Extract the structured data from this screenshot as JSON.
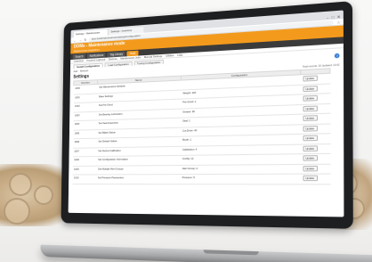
{
  "browser": {
    "tabs": [
      {
        "label": "Settings - Maintenance"
      },
      {
        "label": "Settings - Inventory"
      }
    ],
    "url": "dmx.local/maintenance/settings/configuration"
  },
  "app": {
    "title": "DDMx - Maintenance mode",
    "subtitle": "Maintenance Integration",
    "toolbar": [
      "Search",
      "Notifications",
      "Tag Library",
      "Tools"
    ],
    "toolbar_selected": 3,
    "menus": [
      "Overview",
      "Process Logbook",
      "Devices",
      "Maintenance Jobs",
      "Manual Settings",
      "Utilities",
      "Help"
    ],
    "subtabs": [
      "Install Configuration",
      "Load Configuration",
      "Tuning Configuration"
    ],
    "subtab_selected": 0,
    "tools": [
      "Add",
      "Refresh"
    ],
    "heading": "Settings",
    "help_icon": "question-circle-icon",
    "record_info": "Total records: 30   Updated: 10:42"
  },
  "table": {
    "headers": [
      "Number",
      "Name",
      "Configuration",
      ""
    ],
    "action_label": "Update",
    "rows": [
      {
        "id": "1000",
        "name": "Set Maintenance Defaults",
        "config": "",
        "action": "Update"
      },
      {
        "id": "1001",
        "name": "Base Settings",
        "config": "Weight: 100",
        "action": "Update"
      },
      {
        "id": "1002",
        "name": "Set Pre-Grind",
        "config": "Pre-Grind: 1",
        "action": "Update"
      },
      {
        "id": "1003",
        "name": "Set Bearing Lubrication",
        "config": "Grease: 90",
        "action": "Update"
      },
      {
        "id": "1004",
        "name": "Set Seal Inspection",
        "config": "Seal: 1",
        "action": "Update"
      },
      {
        "id": "1005",
        "name": "Set Blade Status",
        "config": "Cut Drive: 40",
        "action": "Update"
      },
      {
        "id": "1006",
        "name": "Set Default Values",
        "config": "Mode: 1",
        "action": "Update"
      },
      {
        "id": "1007",
        "name": "Set Device Calibration",
        "config": "Calibration: 4",
        "action": "Update"
      },
      {
        "id": "1008",
        "name": "Set Configuration Information",
        "config": "Config: 12",
        "action": "Update"
      },
      {
        "id": "1009",
        "name": "Set Multiple Alert Groups",
        "config": "Alert Group: 2",
        "action": "Update"
      },
      {
        "id": "1010",
        "name": "Set Pressure Parameters",
        "config": "Pressure: 5",
        "action": "Update"
      }
    ]
  }
}
